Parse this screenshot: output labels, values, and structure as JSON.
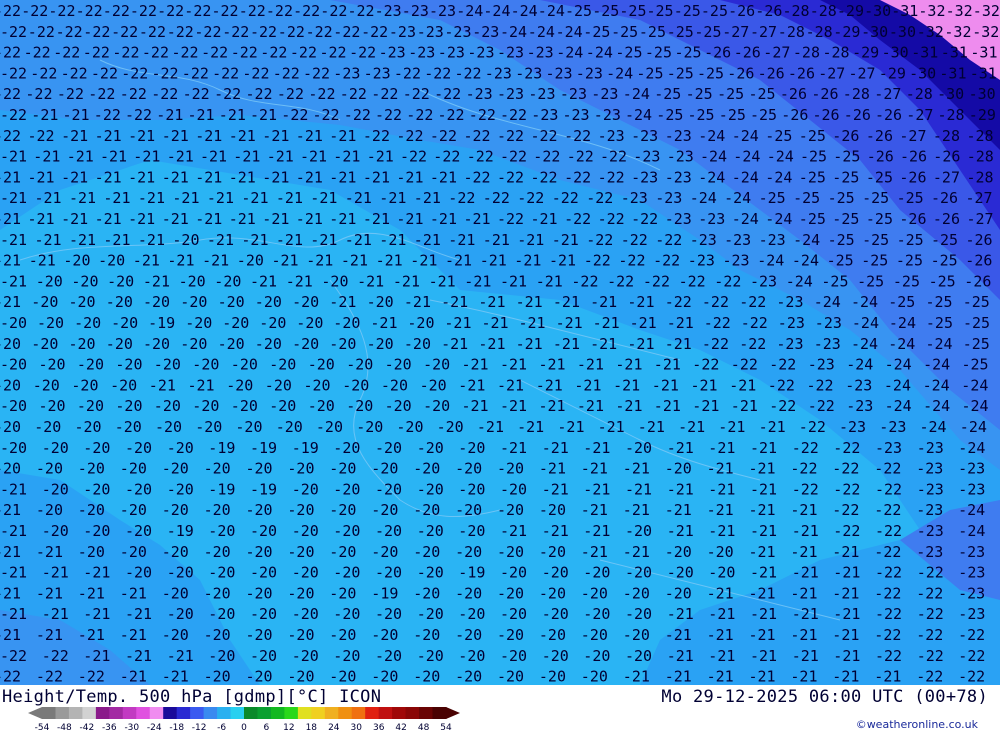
{
  "map": {
    "grid_rows": [
      {
        "vals": [
          22,
          22,
          22,
          22,
          22,
          22,
          22,
          22,
          22,
          22,
          22,
          22,
          22,
          22,
          23,
          23,
          23,
          24,
          24,
          24,
          24,
          25,
          25,
          25,
          25,
          25,
          25,
          26,
          26,
          28,
          28,
          29,
          30,
          31,
          32,
          32,
          32
        ]
      },
      {
        "vals": [
          22,
          22,
          22,
          22,
          22,
          22,
          22,
          22,
          22,
          22,
          22,
          22,
          22,
          22,
          23,
          23,
          23,
          23,
          24,
          24,
          24,
          25,
          25,
          25,
          25,
          25,
          27,
          27,
          28,
          28,
          29,
          30,
          30,
          32,
          32,
          32
        ]
      },
      {
        "vals": [
          22,
          22,
          22,
          22,
          22,
          22,
          22,
          22,
          22,
          22,
          22,
          22,
          22,
          23,
          23,
          23,
          23,
          23,
          23,
          24,
          24,
          25,
          25,
          25,
          26,
          26,
          27,
          28,
          28,
          29,
          30,
          31,
          31,
          31
        ]
      },
      {
        "vals": [
          22,
          22,
          22,
          22,
          22,
          22,
          22,
          22,
          22,
          22,
          22,
          23,
          23,
          22,
          22,
          22,
          23,
          23,
          23,
          23,
          24,
          25,
          25,
          25,
          26,
          26,
          26,
          27,
          27,
          29,
          30,
          31,
          31
        ]
      },
      {
        "vals": [
          22,
          22,
          22,
          22,
          22,
          22,
          22,
          22,
          22,
          22,
          22,
          22,
          22,
          22,
          22,
          23,
          23,
          23,
          23,
          23,
          24,
          25,
          25,
          25,
          25,
          26,
          26,
          28,
          27,
          28,
          30,
          30
        ]
      },
      {
        "vals": [
          22,
          21,
          21,
          22,
          22,
          21,
          21,
          21,
          21,
          22,
          22,
          22,
          22,
          22,
          22,
          22,
          22,
          23,
          23,
          23,
          24,
          25,
          25,
          25,
          25,
          26,
          26,
          26,
          26,
          27,
          28,
          29
        ]
      },
      {
        "vals": [
          22,
          22,
          21,
          21,
          21,
          21,
          21,
          21,
          21,
          21,
          21,
          22,
          22,
          22,
          22,
          22,
          22,
          22,
          23,
          23,
          23,
          24,
          24,
          25,
          25,
          26,
          26,
          27,
          28,
          28
        ]
      },
      {
        "vals": [
          21,
          21,
          21,
          21,
          21,
          21,
          21,
          21,
          21,
          21,
          21,
          21,
          22,
          22,
          22,
          22,
          22,
          22,
          22,
          23,
          23,
          24,
          24,
          24,
          25,
          25,
          26,
          26,
          26,
          28
        ]
      },
      {
        "vals": [
          21,
          21,
          21,
          21,
          21,
          21,
          21,
          21,
          21,
          21,
          21,
          21,
          21,
          21,
          22,
          22,
          22,
          22,
          22,
          23,
          23,
          24,
          24,
          24,
          25,
          25,
          25,
          26,
          27,
          28
        ]
      },
      {
        "vals": [
          21,
          21,
          21,
          21,
          21,
          21,
          21,
          21,
          21,
          21,
          21,
          21,
          21,
          22,
          22,
          22,
          22,
          22,
          23,
          23,
          24,
          24,
          25,
          25,
          25,
          25,
          25,
          26,
          27
        ]
      },
      {
        "vals": [
          21,
          21,
          21,
          21,
          21,
          21,
          21,
          21,
          21,
          21,
          21,
          21,
          21,
          21,
          21,
          22,
          21,
          22,
          22,
          22,
          23,
          23,
          24,
          24,
          25,
          25,
          25,
          26,
          26,
          27
        ]
      },
      {
        "vals": [
          21,
          21,
          21,
          21,
          21,
          20,
          21,
          21,
          21,
          21,
          21,
          21,
          21,
          21,
          21,
          21,
          21,
          22,
          22,
          22,
          23,
          23,
          23,
          24,
          25,
          25,
          25,
          25,
          26
        ]
      },
      {
        "vals": [
          21,
          21,
          20,
          20,
          21,
          21,
          21,
          20,
          21,
          21,
          21,
          21,
          21,
          21,
          21,
          21,
          21,
          22,
          22,
          22,
          23,
          23,
          24,
          24,
          25,
          25,
          25,
          25,
          26
        ]
      },
      {
        "vals": [
          21,
          20,
          20,
          20,
          21,
          20,
          20,
          21,
          21,
          20,
          21,
          21,
          21,
          21,
          21,
          21,
          22,
          22,
          22,
          22,
          22,
          23,
          24,
          25,
          25,
          25,
          25,
          26
        ]
      },
      {
        "vals": [
          21,
          20,
          20,
          20,
          20,
          20,
          20,
          20,
          20,
          21,
          20,
          21,
          21,
          21,
          21,
          21,
          21,
          21,
          22,
          22,
          22,
          23,
          24,
          24,
          25,
          25,
          25
        ]
      },
      {
        "vals": [
          20,
          20,
          20,
          20,
          19,
          20,
          20,
          20,
          20,
          20,
          21,
          20,
          21,
          21,
          21,
          21,
          21,
          21,
          21,
          22,
          22,
          23,
          23,
          24,
          24,
          25,
          25
        ]
      },
      {
        "vals": [
          20,
          20,
          20,
          20,
          20,
          20,
          20,
          20,
          20,
          20,
          20,
          20,
          21,
          21,
          21,
          21,
          21,
          21,
          21,
          22,
          22,
          23,
          23,
          24,
          24,
          24,
          25
        ]
      },
      {
        "vals": [
          20,
          20,
          20,
          20,
          20,
          20,
          20,
          20,
          20,
          20,
          20,
          20,
          21,
          21,
          21,
          21,
          21,
          21,
          22,
          22,
          22,
          23,
          24,
          24,
          24,
          25
        ]
      },
      {
        "vals": [
          20,
          20,
          20,
          20,
          21,
          21,
          20,
          20,
          20,
          20,
          20,
          20,
          21,
          21,
          21,
          21,
          21,
          21,
          21,
          21,
          22,
          22,
          23,
          24,
          24,
          24
        ]
      },
      {
        "vals": [
          20,
          20,
          20,
          20,
          20,
          20,
          20,
          20,
          20,
          20,
          20,
          20,
          21,
          21,
          21,
          21,
          21,
          21,
          21,
          21,
          22,
          22,
          23,
          24,
          24,
          24
        ]
      },
      {
        "vals": [
          20,
          20,
          20,
          20,
          20,
          20,
          20,
          20,
          20,
          20,
          20,
          20,
          21,
          21,
          21,
          21,
          21,
          21,
          21,
          21,
          22,
          23,
          23,
          24,
          24
        ]
      },
      {
        "vals": [
          20,
          20,
          20,
          20,
          20,
          19,
          19,
          19,
          20,
          20,
          20,
          20,
          21,
          21,
          21,
          20,
          21,
          21,
          21,
          22,
          22,
          23,
          23,
          24
        ]
      },
      {
        "vals": [
          20,
          20,
          20,
          20,
          20,
          20,
          20,
          20,
          20,
          20,
          20,
          20,
          20,
          21,
          21,
          21,
          20,
          21,
          21,
          22,
          22,
          22,
          23,
          23
        ]
      },
      {
        "vals": [
          21,
          20,
          20,
          20,
          20,
          19,
          19,
          20,
          20,
          20,
          20,
          20,
          20,
          21,
          21,
          21,
          21,
          21,
          21,
          22,
          22,
          22,
          23,
          23
        ]
      },
      {
        "vals": [
          21,
          20,
          20,
          20,
          20,
          20,
          20,
          20,
          20,
          20,
          20,
          20,
          20,
          20,
          21,
          21,
          21,
          21,
          21,
          21,
          22,
          22,
          23,
          24
        ]
      },
      {
        "vals": [
          21,
          20,
          20,
          20,
          19,
          20,
          20,
          20,
          20,
          20,
          20,
          20,
          21,
          21,
          21,
          20,
          21,
          21,
          21,
          21,
          22,
          22,
          23,
          24
        ]
      },
      {
        "vals": [
          21,
          21,
          20,
          20,
          20,
          20,
          20,
          20,
          20,
          20,
          20,
          20,
          20,
          20,
          21,
          21,
          20,
          20,
          21,
          21,
          21,
          22,
          23,
          23
        ]
      },
      {
        "vals": [
          21,
          21,
          21,
          20,
          20,
          20,
          20,
          20,
          20,
          20,
          20,
          19,
          20,
          20,
          20,
          20,
          20,
          20,
          21,
          21,
          21,
          22,
          22,
          23
        ]
      },
      {
        "vals": [
          21,
          21,
          21,
          21,
          20,
          20,
          20,
          20,
          20,
          19,
          20,
          20,
          20,
          20,
          20,
          20,
          20,
          21,
          21,
          21,
          21,
          22,
          22,
          23
        ]
      },
      {
        "vals": [
          21,
          21,
          21,
          21,
          20,
          20,
          20,
          20,
          20,
          20,
          20,
          20,
          20,
          20,
          20,
          20,
          21,
          21,
          21,
          21,
          21,
          22,
          22,
          23
        ]
      },
      {
        "vals": [
          21,
          21,
          21,
          21,
          20,
          20,
          20,
          20,
          20,
          20,
          20,
          20,
          20,
          20,
          20,
          20,
          21,
          21,
          21,
          21,
          21,
          22,
          22,
          22
        ]
      },
      {
        "vals": [
          22,
          22,
          21,
          21,
          21,
          20,
          20,
          20,
          20,
          20,
          20,
          20,
          20,
          20,
          20,
          20,
          21,
          21,
          21,
          21,
          21,
          22,
          22,
          22
        ]
      },
      {
        "vals": [
          22,
          22,
          22,
          21,
          21,
          20,
          20,
          20,
          20,
          20,
          20,
          20,
          20,
          20,
          20,
          21,
          21,
          21,
          21,
          21,
          21,
          21,
          22,
          22
        ]
      }
    ]
  },
  "footer": {
    "title": "Height/Temp. 500 hPa [gdmp][°C] ICON",
    "datetime": "Mo 29-12-2025 06:00 UTC (00+78)",
    "credit": "©weatheronline.co.uk"
  },
  "legend": {
    "colors": [
      "#7a7a7a",
      "#9a9a9a",
      "#b4b4b4",
      "#d2d2d2",
      "#8a1a8a",
      "#a32aa3",
      "#c23ac2",
      "#e050e0",
      "#f08cf0",
      "#1a0a9a",
      "#2a2ad2",
      "#3a5af0",
      "#3a8af0",
      "#2ab0f0",
      "#28d0f0",
      "#0a8a2a",
      "#0aa030",
      "#12b820",
      "#2ad81a",
      "#e0e020",
      "#f0d020",
      "#f0b020",
      "#f09010",
      "#f07010",
      "#e02010",
      "#c01010",
      "#a00808",
      "#8a0606",
      "#6a0404",
      "#4a0202"
    ],
    "ticks": [
      "-54",
      "-48",
      "-42",
      "-36",
      "-30",
      "-24",
      "-18",
      "-12",
      "-6",
      "0",
      "6",
      "12",
      "18",
      "24",
      "30",
      "36",
      "42",
      "48",
      "54"
    ]
  }
}
